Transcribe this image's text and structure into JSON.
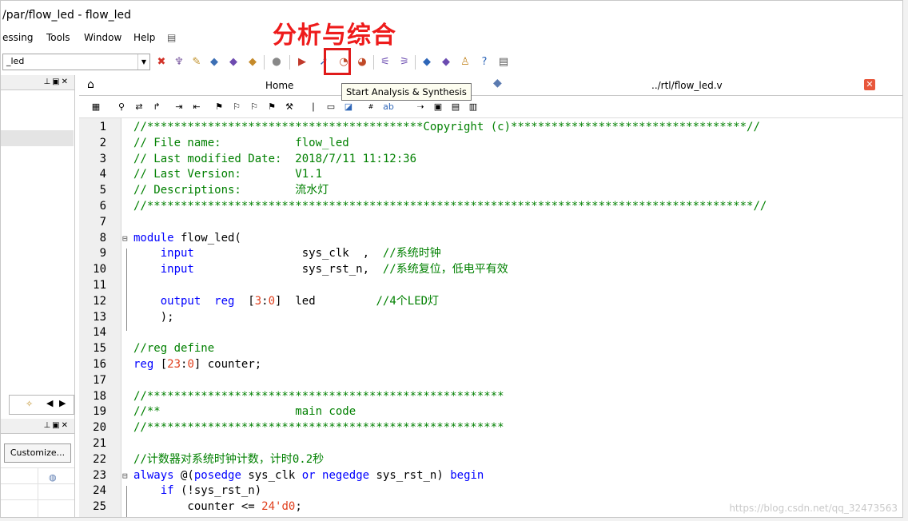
{
  "window": {
    "title": "/par/flow_led - flow_led",
    "annotation": "分析与综合"
  },
  "menu": {
    "items": [
      "essing",
      "Tools",
      "Window",
      "Help"
    ]
  },
  "toolbar": {
    "project_combo": "_led",
    "tooltip": "Start Analysis & Synthesis"
  },
  "tabs": {
    "home": "Home",
    "file": "../rtl/flow_led.v"
  },
  "left_panel": {
    "customize_button": "Customize..."
  },
  "editor": {
    "lines": [
      {
        "n": "1",
        "segs": [
          {
            "t": "//*****************************************Copyright (c)***********************************//",
            "c": "c"
          }
        ]
      },
      {
        "n": "2",
        "segs": [
          {
            "t": "// File name:           flow_led",
            "c": "c"
          }
        ]
      },
      {
        "n": "3",
        "segs": [
          {
            "t": "// Last modified Date:  2018/7/11 11:12:36",
            "c": "c"
          }
        ]
      },
      {
        "n": "4",
        "segs": [
          {
            "t": "// Last Version:        V1.1",
            "c": "c"
          }
        ]
      },
      {
        "n": "5",
        "segs": [
          {
            "t": "// Descriptions:        流水灯",
            "c": "c"
          }
        ]
      },
      {
        "n": "6",
        "segs": [
          {
            "t": "//******************************************************************************************//",
            "c": "c"
          }
        ]
      },
      {
        "n": "7",
        "segs": []
      },
      {
        "n": "8",
        "fold": "⊟",
        "segs": [
          {
            "t": "module",
            "c": "k"
          },
          {
            "t": " flow_led(",
            "c": "p"
          }
        ]
      },
      {
        "n": "9",
        "segs": [
          {
            "t": "    input",
            "c": "k"
          },
          {
            "t": "                sys_clk  ,  ",
            "c": "p"
          },
          {
            "t": "//系统时钟",
            "c": "c"
          }
        ]
      },
      {
        "n": "10",
        "segs": [
          {
            "t": "    input",
            "c": "k"
          },
          {
            "t": "                sys_rst_n,  ",
            "c": "p"
          },
          {
            "t": "//系统复位，低电平有效",
            "c": "c"
          }
        ]
      },
      {
        "n": "11",
        "segs": []
      },
      {
        "n": "12",
        "segs": [
          {
            "t": "    output  reg  ",
            "c": "k"
          },
          {
            "t": "[",
            "c": "p"
          },
          {
            "t": "3",
            "c": "n"
          },
          {
            "t": ":",
            "c": "p"
          },
          {
            "t": "0",
            "c": "n"
          },
          {
            "t": "]  led         ",
            "c": "p"
          },
          {
            "t": "//4个LED灯",
            "c": "c"
          }
        ]
      },
      {
        "n": "13",
        "segs": [
          {
            "t": "    );",
            "c": "p"
          }
        ]
      },
      {
        "n": "14",
        "segs": []
      },
      {
        "n": "15",
        "segs": [
          {
            "t": "//reg define",
            "c": "c"
          }
        ]
      },
      {
        "n": "16",
        "segs": [
          {
            "t": "reg",
            "c": "k"
          },
          {
            "t": " [",
            "c": "p"
          },
          {
            "t": "23",
            "c": "n"
          },
          {
            "t": ":",
            "c": "p"
          },
          {
            "t": "0",
            "c": "n"
          },
          {
            "t": "] counter;",
            "c": "p"
          }
        ]
      },
      {
        "n": "17",
        "segs": []
      },
      {
        "n": "18",
        "segs": [
          {
            "t": "//*****************************************************",
            "c": "c"
          }
        ]
      },
      {
        "n": "19",
        "segs": [
          {
            "t": "//**                    main code",
            "c": "c"
          }
        ]
      },
      {
        "n": "20",
        "segs": [
          {
            "t": "//*****************************************************",
            "c": "c"
          }
        ]
      },
      {
        "n": "21",
        "segs": []
      },
      {
        "n": "22",
        "segs": [
          {
            "t": "//计数器对系统时钟计数，计时0.2秒",
            "c": "c"
          }
        ]
      },
      {
        "n": "23",
        "fold": "⊟",
        "segs": [
          {
            "t": "always",
            "c": "k"
          },
          {
            "t": " @(",
            "c": "p"
          },
          {
            "t": "posedge",
            "c": "k"
          },
          {
            "t": " sys_clk ",
            "c": "p"
          },
          {
            "t": "or",
            "c": "k"
          },
          {
            "t": " ",
            "c": "p"
          },
          {
            "t": "negedge",
            "c": "k"
          },
          {
            "t": " sys_rst_n) ",
            "c": "p"
          },
          {
            "t": "begin",
            "c": "k"
          }
        ]
      },
      {
        "n": "24",
        "segs": [
          {
            "t": "    if",
            "c": "k"
          },
          {
            "t": " (!sys_rst_n)",
            "c": "p"
          }
        ]
      },
      {
        "n": "25",
        "segs": [
          {
            "t": "        counter <= ",
            "c": "p"
          },
          {
            "t": "24'd0",
            "c": "n"
          },
          {
            "t": ";",
            "c": "p"
          }
        ]
      }
    ]
  },
  "watermark": "https://blog.csdn.net/qq_32473563",
  "colors": {
    "comment": "#008000",
    "keyword": "#0000ff",
    "number": "#e0401e",
    "annotation": "#ee1b1b",
    "highlight_box": "#e01b1b"
  }
}
